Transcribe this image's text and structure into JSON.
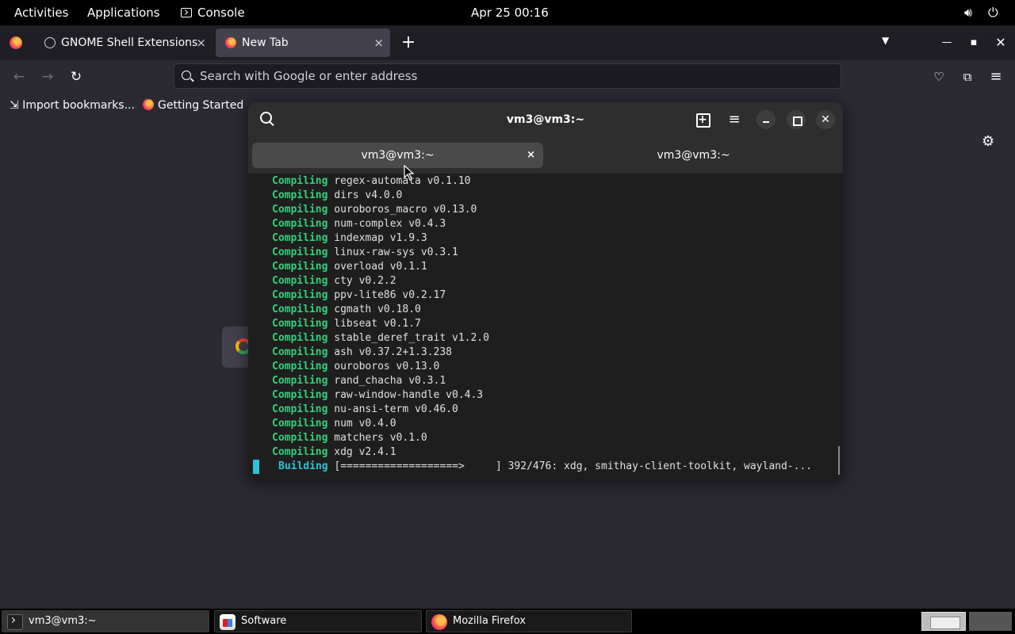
{
  "topbar": {
    "activities": "Activities",
    "applications": "Applications",
    "console": "Console",
    "clock": "Apr 25  00:16"
  },
  "firefox": {
    "tabs": [
      {
        "label": "GNOME Shell Extensions",
        "close": "×"
      },
      {
        "label": "New Tab",
        "close": "×"
      }
    ],
    "new_tab": "+",
    "url_placeholder": "Search with Google or enter address",
    "bookmarks": [
      "Import bookmarks...",
      "Getting Started"
    ]
  },
  "console": {
    "title": "vm3@vm3:~",
    "tabs": [
      {
        "label": "vm3@vm3:~",
        "close": "×"
      },
      {
        "label": "vm3@vm3:~"
      }
    ],
    "lines": [
      {
        "kw": "Compiling",
        "text": " regex-automata v0.1.10"
      },
      {
        "kw": "Compiling",
        "text": " dirs v4.0.0"
      },
      {
        "kw": "Compiling",
        "text": " ouroboros_macro v0.13.0"
      },
      {
        "kw": "Compiling",
        "text": " num-complex v0.4.3"
      },
      {
        "kw": "Compiling",
        "text": " indexmap v1.9.3"
      },
      {
        "kw": "Compiling",
        "text": " linux-raw-sys v0.3.1"
      },
      {
        "kw": "Compiling",
        "text": " overload v0.1.1"
      },
      {
        "kw": "Compiling",
        "text": " cty v0.2.2"
      },
      {
        "kw": "Compiling",
        "text": " ppv-lite86 v0.2.17"
      },
      {
        "kw": "Compiling",
        "text": " cgmath v0.18.0"
      },
      {
        "kw": "Compiling",
        "text": " libseat v0.1.7"
      },
      {
        "kw": "Compiling",
        "text": " stable_deref_trait v1.2.0"
      },
      {
        "kw": "Compiling",
        "text": " ash v0.37.2+1.3.238"
      },
      {
        "kw": "Compiling",
        "text": " ouroboros v0.13.0"
      },
      {
        "kw": "Compiling",
        "text": " rand_chacha v0.3.1"
      },
      {
        "kw": "Compiling",
        "text": " raw-window-handle v0.4.3"
      },
      {
        "kw": "Compiling",
        "text": " nu-ansi-term v0.46.0"
      },
      {
        "kw": "Compiling",
        "text": " num v0.4.0"
      },
      {
        "kw": "Compiling",
        "text": " matchers v0.1.0"
      },
      {
        "kw": "Compiling",
        "text": " xdg v2.4.1"
      }
    ],
    "status": {
      "kw": "Building",
      "text": " [===================>     ] 392/476: xdg, smithay-client-toolkit, wayland-..."
    }
  },
  "taskbar": {
    "items": [
      "vm3@vm3:~",
      "Software",
      "Mozilla Firefox"
    ]
  }
}
